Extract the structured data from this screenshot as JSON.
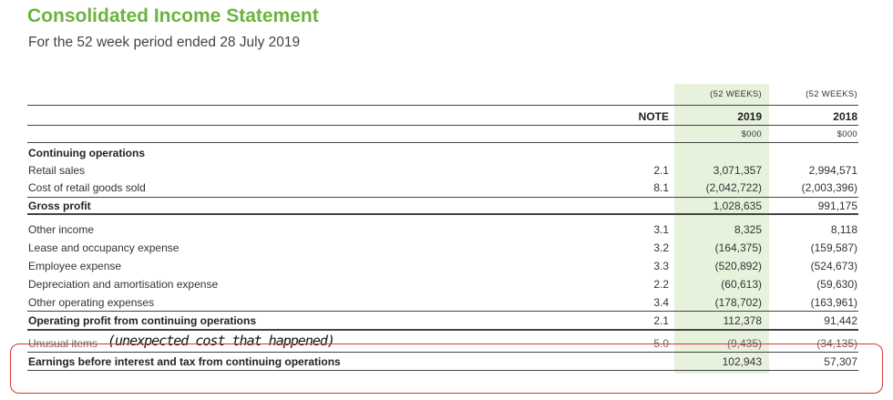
{
  "header": {
    "title": "Consolidated Income Statement",
    "subtitle": "For the 52 week period ended 28 July 2019"
  },
  "columns": {
    "period_2019": "(52 WEEKS)",
    "period_2018": "(52 WEEKS)",
    "note": "NOTE",
    "year_2019": "2019",
    "year_2018": "2018",
    "unit_2019": "$000",
    "unit_2018": "$000"
  },
  "section_heading": "Continuing operations",
  "rows": [
    {
      "label": "Retail sales",
      "note": "2.1",
      "y2019": "3,071,357",
      "y2018": "2,994,571"
    },
    {
      "label": "Cost of retail goods sold",
      "note": "8.1",
      "y2019": "(2,042,722)",
      "y2018": "(2,003,396)"
    },
    {
      "label": "Gross profit",
      "note": "",
      "y2019": "1,028,635",
      "y2018": "991,175"
    },
    {
      "label": "Other income",
      "note": "3.1",
      "y2019": "8,325",
      "y2018": "8,118"
    },
    {
      "label": "Lease and occupancy expense",
      "note": "3.2",
      "y2019": "(164,375)",
      "y2018": "(159,587)"
    },
    {
      "label": "Employee expense",
      "note": "3.3",
      "y2019": "(520,892)",
      "y2018": "(524,673)"
    },
    {
      "label": "Depreciation and amortisation expense",
      "note": "2.2",
      "y2019": "(60,613)",
      "y2018": "(59,630)"
    },
    {
      "label": "Other operating expenses",
      "note": "3.4",
      "y2019": "(178,702)",
      "y2018": "(163,961)"
    },
    {
      "label": "Operating profit from continuing operations",
      "note": "2.1",
      "y2019": "112,378",
      "y2018": "91,442"
    },
    {
      "label": "Unusual items",
      "note": "5.0",
      "y2019": "(9,435)",
      "y2018": "(34,135)"
    },
    {
      "label": "Earnings before interest and tax from continuing operations",
      "note": "",
      "y2019": "102,943",
      "y2018": "57,307"
    }
  ],
  "annotation": "(unexpected cost that happened)",
  "colors": {
    "title": "#6cb33f",
    "highlight": "#e7f2dd",
    "callout": "#dd3333"
  }
}
